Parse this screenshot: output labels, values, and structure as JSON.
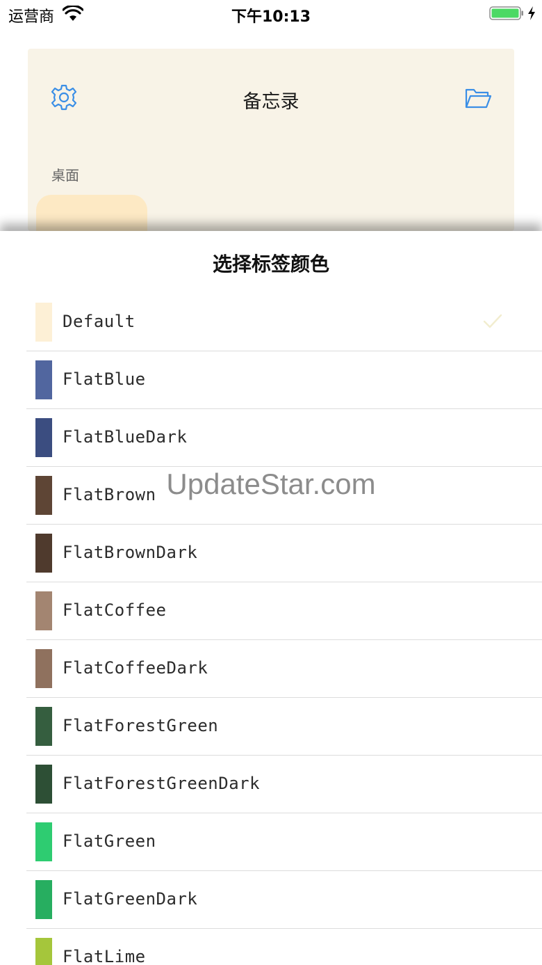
{
  "status_bar": {
    "carrier": "运营商",
    "time": "下午10:13"
  },
  "app": {
    "title": "备忘录",
    "section_label": "桌面",
    "settings_icon": "gear-icon",
    "folder_icon": "folder-icon"
  },
  "sheet": {
    "title": "选择标签颜色",
    "selected_index": 0
  },
  "colors": [
    {
      "name": "Default",
      "hex": "#fdf0d6"
    },
    {
      "name": "FlatBlue",
      "hex": "#51669f"
    },
    {
      "name": "FlatBlueDark",
      "hex": "#3b4d80"
    },
    {
      "name": "FlatBrown",
      "hex": "#5e4535"
    },
    {
      "name": "FlatBrownDark",
      "hex": "#4f3a2d"
    },
    {
      "name": "FlatCoffee",
      "hex": "#a38571"
    },
    {
      "name": "FlatCoffeeDark",
      "hex": "#8f715e"
    },
    {
      "name": "FlatForestGreen",
      "hex": "#355e3f"
    },
    {
      "name": "FlatForestGreenDark",
      "hex": "#2d4f35"
    },
    {
      "name": "FlatGreen",
      "hex": "#2ecc71"
    },
    {
      "name": "FlatGreenDark",
      "hex": "#27ae60"
    },
    {
      "name": "FlatLime",
      "hex": "#a5c63b"
    }
  ],
  "watermark": "UpdateStar.com"
}
